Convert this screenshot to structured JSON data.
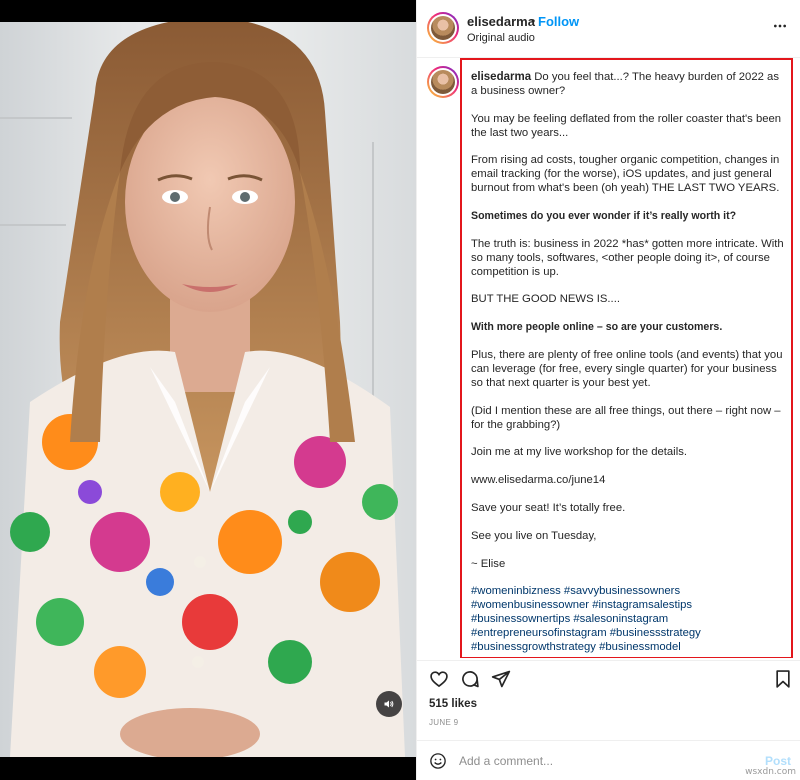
{
  "header": {
    "username": "elisedarma",
    "separator": "•",
    "follow_label": "Follow",
    "subtitle": "Original audio",
    "more_icon": "more-horizontal-icon"
  },
  "caption": {
    "username": "elisedarma",
    "lead": "Do you feel that...? The heavy burden of 2022 as a business owner?",
    "paragraphs": [
      "You may be feeling deflated from the roller coaster that's been the last two years...",
      "From rising ad costs, tougher organic competition, changes in email tracking (for the worse), iOS updates, and just general burnout from what's been (oh yeah) THE LAST TWO YEARS.",
      "Sometimes do you ever wonder if it’s really worth it?",
      "The truth is: business in 2022 *has* gotten more intricate. With so many tools, softwares, <other people doing it>, of course competition is up.",
      "BUT THE GOOD NEWS IS....",
      "With more people online – so are your customers.",
      "Plus, there are plenty of free online tools (and events) that you can leverage (for free, every single quarter) for your business so that next quarter is your best yet.",
      "(Did I mention these are all free things, out there – right now – for the grabbing?)",
      "Join me at my live workshop for the details.",
      "www.elisedarma.co/june14",
      "Save your seat! It’s totally free.",
      "See you live on Tuesday,",
      "~ Elise"
    ],
    "hashtag_lines": [
      "#womeninbizness #savvybusinessowners",
      "#womenbusinessowner #instagramsalestips",
      "#businessownertips #salesoninstagram",
      "#entrepreneursofinstagram #businessstrategy",
      "#businessgrowthstrategy #businessmodel"
    ],
    "highlight_color": "#e3161c"
  },
  "actions": {
    "like_icon": "heart-icon",
    "comment_icon": "comment-icon",
    "share_icon": "send-icon",
    "save_icon": "bookmark-icon"
  },
  "likes": "515 likes",
  "date": "JUNE 9",
  "comment": {
    "placeholder": "Add a comment...",
    "post_label": "Post",
    "emoji_icon": "emoji-icon"
  },
  "media": {
    "mute_icon": "speaker-icon"
  },
  "watermark": "wsxdn.com",
  "colors": {
    "link": "#0095f6",
    "hashtag": "#00376b",
    "muted": "#8e8e8e"
  }
}
